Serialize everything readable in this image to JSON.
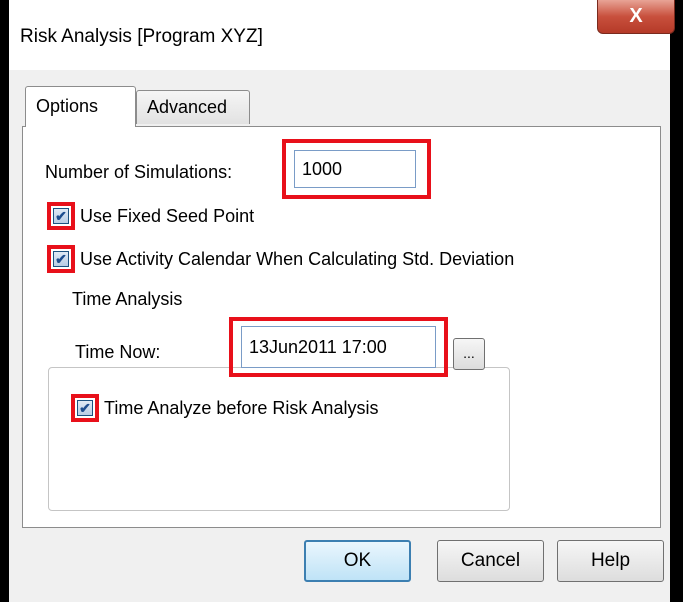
{
  "window": {
    "title": "Risk Analysis [Program XYZ]",
    "close_glyph": "X"
  },
  "tabs": [
    {
      "label": "Options",
      "selected": true
    },
    {
      "label": "Advanced",
      "selected": false
    }
  ],
  "options": {
    "simulations_label": "Number of Simulations:",
    "simulations_value": "1000",
    "fixed_seed_label": "Use Fixed Seed Point",
    "fixed_seed_checked": true,
    "activity_calendar_label": "Use Activity Calendar When Calculating Std. Deviation",
    "activity_calendar_checked": true
  },
  "time_analysis": {
    "group_title": "Time Analysis",
    "time_now_label": "Time Now:",
    "time_now_value": "13Jun2011 17:00",
    "browse_label": "...",
    "analyze_label": "Time Analyze before Risk Analysis",
    "analyze_checked": true
  },
  "buttons": {
    "ok": "OK",
    "cancel": "Cancel",
    "help": "Help"
  },
  "colors": {
    "highlight": "#e8101a",
    "close_button": "#c8503d",
    "focus_button": "#3c7fb1"
  }
}
